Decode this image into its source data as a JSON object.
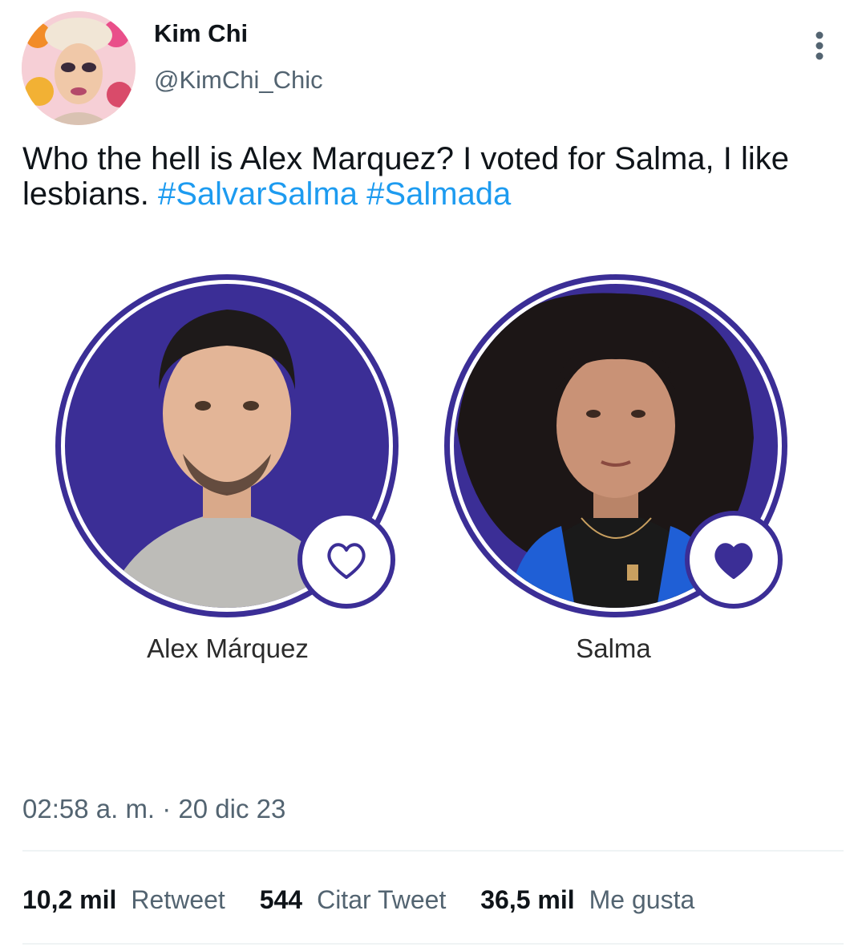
{
  "tweet": {
    "display_name": "Kim Chi",
    "handle": "@KimChi_Chic",
    "text_plain": "Who the hell is Alex Marquez? I voted for Salma, I like lesbians.",
    "hashtags": [
      "#SalvarSalma",
      "#Salmada"
    ],
    "timestamp": "02:58 a. m. · 20 dic 23"
  },
  "poll_image": {
    "accent_color": "#3b2e96",
    "candidates": [
      {
        "name": "Alex Márquez",
        "heart": "heart-outline-icon",
        "selected": false
      },
      {
        "name": "Salma",
        "heart": "heart-filled-icon",
        "selected": true
      }
    ]
  },
  "stats": {
    "retweets_count": "10,2 mil",
    "retweets_label": "Retweet",
    "quotes_count": "544",
    "quotes_label": "Citar Tweet",
    "likes_count": "36,5 mil",
    "likes_label": "Me gusta"
  },
  "colors": {
    "link": "#1d9bf0",
    "secondary_text": "#536471",
    "primary_text": "#0f1419"
  }
}
